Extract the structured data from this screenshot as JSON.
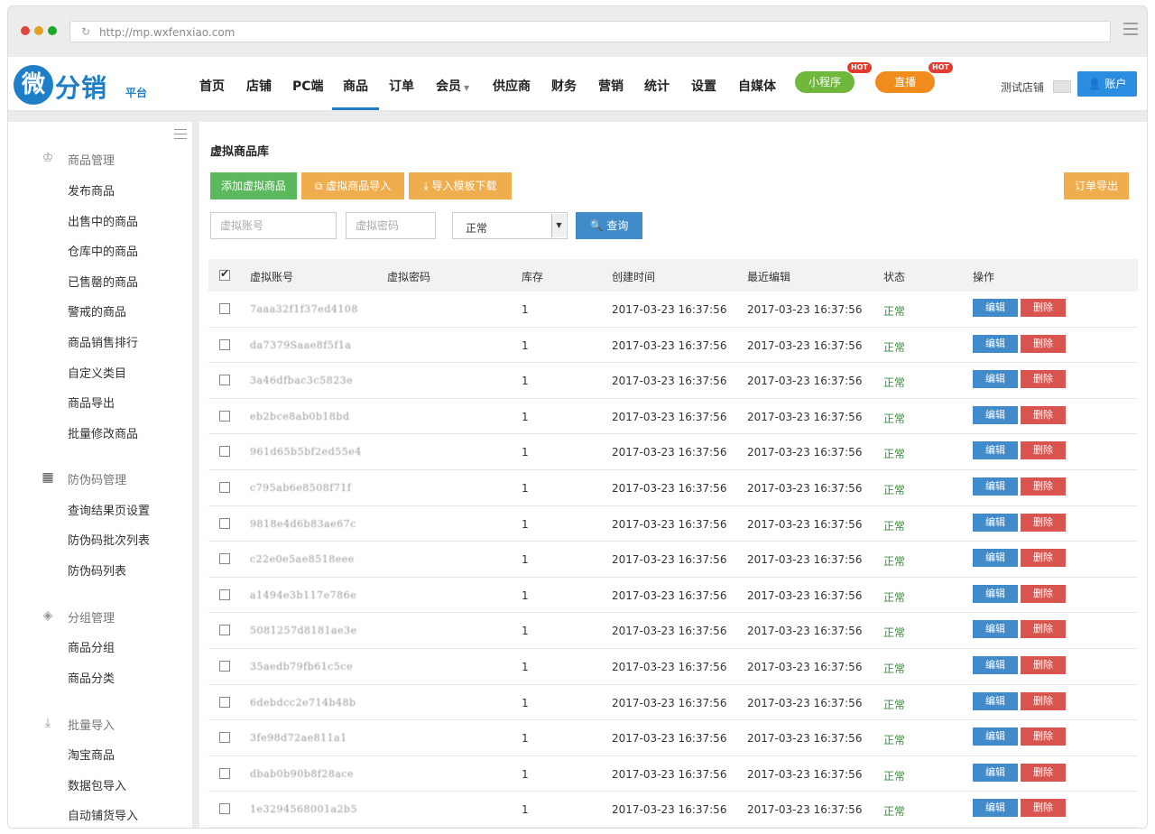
{
  "browser": {
    "url": "http://mp.wxfenxiao.com"
  },
  "logo": {
    "mark": "微",
    "name": "分销",
    "sub": "平台"
  },
  "nav": {
    "items": [
      "首页",
      "店铺",
      "PC端",
      "商品",
      "订单",
      "会员",
      "供应商",
      "财务",
      "营销",
      "统计",
      "设置",
      "自媒体"
    ],
    "active": "商品",
    "mini_program": "小程序",
    "live": "直播",
    "hot": "HOT",
    "shop_name": "测试店铺",
    "account": "账户"
  },
  "sidebar": {
    "sections": [
      {
        "title": "商品管理",
        "icon": "crown-icon",
        "items": [
          "发布商品",
          "出售中的商品",
          "仓库中的商品",
          "已售罄的商品",
          "警戒的商品",
          "商品销售排行",
          "自定义类目",
          "商品导出",
          "批量修改商品"
        ]
      },
      {
        "title": "防伪码管理",
        "icon": "qrcode-icon",
        "items": [
          "查询结果页设置",
          "防伪码批次列表",
          "防伪码列表"
        ]
      },
      {
        "title": "分组管理",
        "icon": "tag-icon",
        "items": [
          "商品分组",
          "商品分类"
        ]
      },
      {
        "title": "批量导入",
        "icon": "import-icon",
        "items": [
          "淘宝商品",
          "数据包导入",
          "自动铺货导入"
        ]
      }
    ]
  },
  "main": {
    "title": "虚拟商品库",
    "buttons": {
      "add": "添加虚拟商品",
      "import": "虚拟商品导入",
      "template": "导入模板下载",
      "export": "订单导出",
      "search": "查询"
    },
    "filters": {
      "account_placeholder": "虚拟账号",
      "password_placeholder": "虚拟密码",
      "status_value": "正常"
    },
    "columns": [
      "虚拟账号",
      "虚拟密码",
      "库存",
      "创建时间",
      "最近编辑",
      "状态",
      "操作"
    ],
    "edit_label": "编辑",
    "delete_label": "删除",
    "rows": [
      {
        "account": "7aaa32f1f37ed4108",
        "password": "",
        "stock": "1",
        "created": "2017-03-23 16:37:56",
        "edited": "2017-03-23 16:37:56",
        "status": "正常"
      },
      {
        "account": "da7379Saae8f5f1a",
        "password": "",
        "stock": "1",
        "created": "2017-03-23 16:37:56",
        "edited": "2017-03-23 16:37:56",
        "status": "正常"
      },
      {
        "account": "3a46dfbac3c5823e",
        "password": "",
        "stock": "1",
        "created": "2017-03-23 16:37:56",
        "edited": "2017-03-23 16:37:56",
        "status": "正常"
      },
      {
        "account": "eb2bce8ab0b18bd",
        "password": "",
        "stock": "1",
        "created": "2017-03-23 16:37:56",
        "edited": "2017-03-23 16:37:56",
        "status": "正常"
      },
      {
        "account": "961d65b5bf2ed55e4",
        "password": "",
        "stock": "1",
        "created": "2017-03-23 16:37:56",
        "edited": "2017-03-23 16:37:56",
        "status": "正常"
      },
      {
        "account": "c795ab6e8508f71f",
        "password": "",
        "stock": "1",
        "created": "2017-03-23 16:37:56",
        "edited": "2017-03-23 16:37:56",
        "status": "正常"
      },
      {
        "account": "9818e4d6b83ae67c",
        "password": "",
        "stock": "1",
        "created": "2017-03-23 16:37:56",
        "edited": "2017-03-23 16:37:56",
        "status": "正常"
      },
      {
        "account": "c22e0e5ae8518eee",
        "password": "",
        "stock": "1",
        "created": "2017-03-23 16:37:56",
        "edited": "2017-03-23 16:37:56",
        "status": "正常"
      },
      {
        "account": "a1494e3b117e786e",
        "password": "",
        "stock": "1",
        "created": "2017-03-23 16:37:56",
        "edited": "2017-03-23 16:37:56",
        "status": "正常"
      },
      {
        "account": "5081257d8181ae3e",
        "password": "",
        "stock": "1",
        "created": "2017-03-23 16:37:56",
        "edited": "2017-03-23 16:37:56",
        "status": "正常"
      },
      {
        "account": "35aedb79fb61c5ce",
        "password": "",
        "stock": "1",
        "created": "2017-03-23 16:37:56",
        "edited": "2017-03-23 16:37:56",
        "status": "正常"
      },
      {
        "account": "6debdcc2e714b48b",
        "password": "",
        "stock": "1",
        "created": "2017-03-23 16:37:56",
        "edited": "2017-03-23 16:37:56",
        "status": "正常"
      },
      {
        "account": "3fe98d72ae811a1",
        "password": "",
        "stock": "1",
        "created": "2017-03-23 16:37:56",
        "edited": "2017-03-23 16:37:56",
        "status": "正常"
      },
      {
        "account": "dbab0b90b8f28ace",
        "password": "",
        "stock": "1",
        "created": "2017-03-23 16:37:56",
        "edited": "2017-03-23 16:37:56",
        "status": "正常"
      },
      {
        "account": "1e3294568001a2b5",
        "password": "",
        "stock": "1",
        "created": "2017-03-23 16:37:56",
        "edited": "2017-03-23 16:37:56",
        "status": "正常"
      }
    ]
  },
  "colors": {
    "brand": "#1f7fc6",
    "green": "#5cb85c",
    "orange": "#f0ad4e",
    "blue": "#428bca",
    "red": "#d9534f"
  }
}
